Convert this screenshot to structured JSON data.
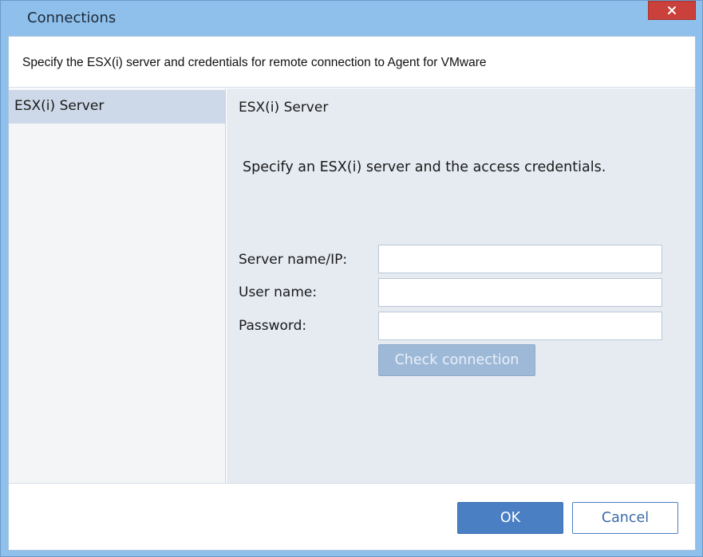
{
  "window": {
    "title": "Connections"
  },
  "header": {
    "text": "Specify the ESX(i) server and credentials for remote connection to Agent for VMware"
  },
  "sidebar": {
    "items": [
      {
        "label": "ESX(i) Server",
        "selected": true
      }
    ]
  },
  "content": {
    "title": "ESX(i) Server",
    "description": "Specify an ESX(i) server and the access credentials.",
    "fields": [
      {
        "label": "Server name/IP:",
        "value": "",
        "placeholder": ""
      },
      {
        "label": "User name:",
        "value": "",
        "placeholder": ""
      },
      {
        "label": "Password:",
        "value": "",
        "placeholder": ""
      }
    ],
    "check_button": "Check connection"
  },
  "footer": {
    "ok_label": "OK",
    "cancel_label": "Cancel"
  },
  "colors": {
    "titlebar": "#8fbfeb",
    "close_button": "#c9413a",
    "ok_button": "#4a7fc4",
    "check_button_disabled": "#9eb9d8"
  },
  "icons": {
    "close": "close-icon"
  }
}
